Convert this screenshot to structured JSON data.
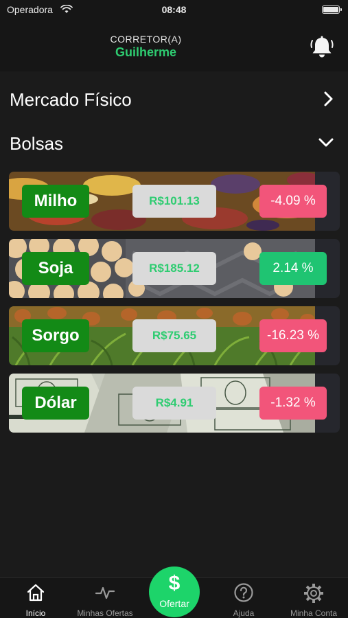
{
  "status_bar": {
    "carrier": "Operadora",
    "time": "08:48"
  },
  "header": {
    "role": "CORRETOR(A)",
    "name": "Guilherme"
  },
  "sections": {
    "mercado_fisico": "Mercado Físico",
    "bolsas": "Bolsas"
  },
  "bolsas": [
    {
      "name": "Milho",
      "price": "R$101.13",
      "change": "-4.09 %",
      "trend": "down"
    },
    {
      "name": "Soja",
      "price": "R$185.12",
      "change": "2.14 %",
      "trend": "up"
    },
    {
      "name": "Sorgo",
      "price": "R$75.65",
      "change": "-16.23 %",
      "trend": "down"
    },
    {
      "name": "Dólar",
      "price": "R$4.91",
      "change": "-1.32 %",
      "trend": "down"
    }
  ],
  "tab_bar": {
    "inicio": "Início",
    "minhas_ofertas": "Minhas Ofertas",
    "ofertar_symbol": "$",
    "ofertar": "Ofertar",
    "ajuda": "Ajuda",
    "minha_conta": "Minha Conta",
    "active": "inicio"
  },
  "colors": {
    "accent": "#2ecc71",
    "negative": "#f2557a",
    "positive": "#1fc472",
    "name_pill": "#138a16",
    "fab": "#1dd46a"
  }
}
